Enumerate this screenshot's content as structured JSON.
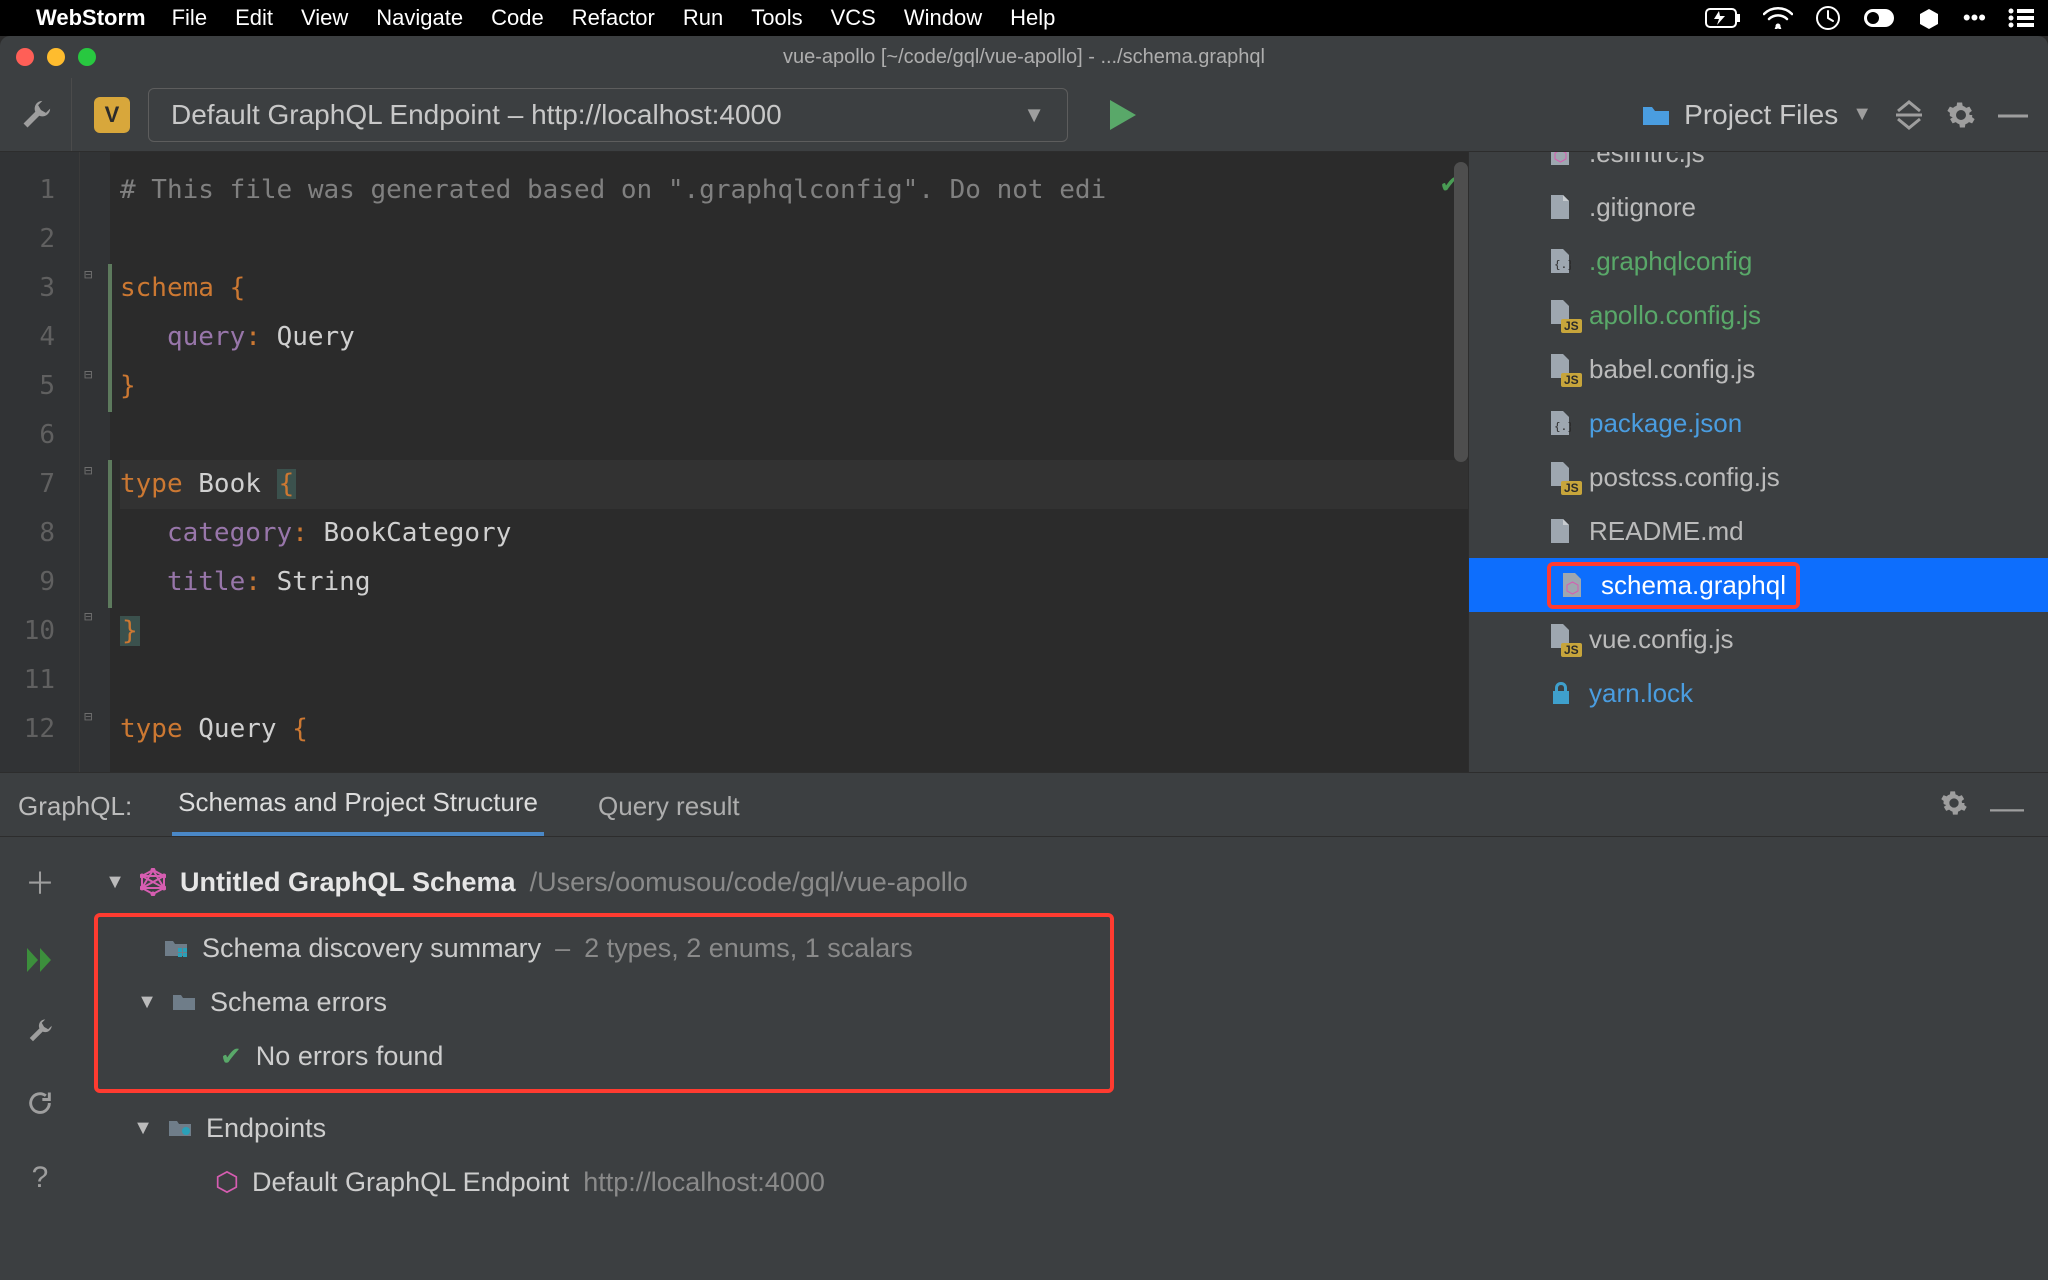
{
  "mac_menu": {
    "app": "WebStorm",
    "items": [
      "File",
      "Edit",
      "View",
      "Navigate",
      "Code",
      "Refactor",
      "Run",
      "Tools",
      "VCS",
      "Window",
      "Help"
    ]
  },
  "window": {
    "title": "vue-apollo [~/code/gql/vue-apollo] - .../schema.graphql"
  },
  "toolbar": {
    "v_badge": "V",
    "endpoint_label": "Default GraphQL Endpoint – http://localhost:4000",
    "project_files": "Project Files"
  },
  "editor": {
    "lines": [
      {
        "n": "1",
        "type": "comment",
        "raw": "# This file was generated based on \".graphqlconfig\". Do not edi"
      },
      {
        "n": "2",
        "type": "blank",
        "raw": ""
      },
      {
        "n": "3",
        "type": "schema",
        "kw": "schema",
        "brace": "{"
      },
      {
        "n": "4",
        "type": "field",
        "name": "query",
        "value": "Query"
      },
      {
        "n": "5",
        "type": "close",
        "brace": "}"
      },
      {
        "n": "6",
        "type": "blank",
        "raw": ""
      },
      {
        "n": "7",
        "type": "typedef",
        "kw": "type",
        "name": "Book",
        "brace": "{",
        "hl": true
      },
      {
        "n": "8",
        "type": "field",
        "name": "category",
        "value": "BookCategory"
      },
      {
        "n": "9",
        "type": "field",
        "name": "title",
        "value": "String"
      },
      {
        "n": "10",
        "type": "close",
        "brace": "}",
        "hl": true
      },
      {
        "n": "11",
        "type": "blank",
        "raw": ""
      },
      {
        "n": "12",
        "type": "typedef",
        "kw": "type",
        "name": "Query",
        "brace": "{"
      }
    ]
  },
  "project_tree": {
    "items": [
      {
        "label": ".eslintrc.js",
        "icon": "gql",
        "cls": "",
        "cut": true
      },
      {
        "label": ".gitignore",
        "icon": "file",
        "cls": ""
      },
      {
        "label": ".graphqlconfig",
        "icon": "cfg",
        "cls": "green"
      },
      {
        "label": "apollo.config.js",
        "icon": "js",
        "cls": "green"
      },
      {
        "label": "babel.config.js",
        "icon": "js",
        "cls": ""
      },
      {
        "label": "package.json",
        "icon": "cfg",
        "cls": "blue"
      },
      {
        "label": "postcss.config.js",
        "icon": "js",
        "cls": ""
      },
      {
        "label": "README.md",
        "icon": "file",
        "cls": ""
      },
      {
        "label": "schema.graphql",
        "icon": "gql",
        "cls": "",
        "selected": true,
        "boxed": true
      },
      {
        "label": "vue.config.js",
        "icon": "js",
        "cls": ""
      },
      {
        "label": "yarn.lock",
        "icon": "lock",
        "cls": "blue"
      }
    ]
  },
  "gql_panel": {
    "name": "GraphQL:",
    "tab_active": "Schemas and Project Structure",
    "tab_other": "Query result",
    "schema_title": "Untitled GraphQL Schema",
    "schema_path": "/Users/oomusou/code/gql/vue-apollo",
    "discovery_label": "Schema discovery summary",
    "discovery_detail": "2 types, 2 enums, 1 scalars",
    "errors_label": "Schema errors",
    "errors_none": "No errors found",
    "endpoints_label": "Endpoints",
    "endpoint_name": "Default GraphQL Endpoint",
    "endpoint_url": "http://localhost:4000"
  }
}
